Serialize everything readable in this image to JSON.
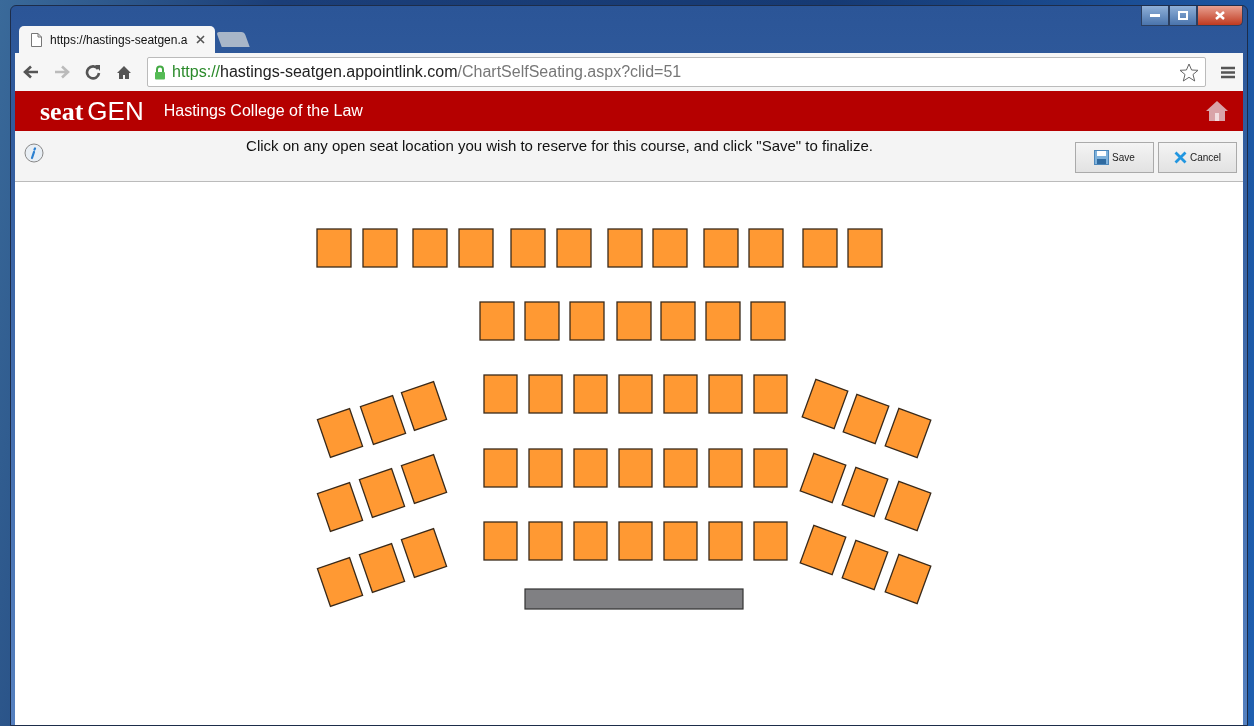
{
  "browser": {
    "tab_title": "https://hastings-seatgen.a",
    "address": {
      "scheme": "https://",
      "host": "hastings-seatgen.appointlink.com",
      "path": "/ChartSelfSeating.aspx?clid=51"
    }
  },
  "header": {
    "logo": {
      "part_1": "seat",
      "part_2": "GEN"
    },
    "title": "Hastings College of the Law"
  },
  "toolbar": {
    "instruction": "Click on any open seat location you wish to reserve for this course, and click \"Save\" to finalize.",
    "buttons": [
      {
        "kind": "save",
        "label": "Save"
      },
      {
        "kind": "cancel",
        "label": "Cancel"
      }
    ]
  }
}
